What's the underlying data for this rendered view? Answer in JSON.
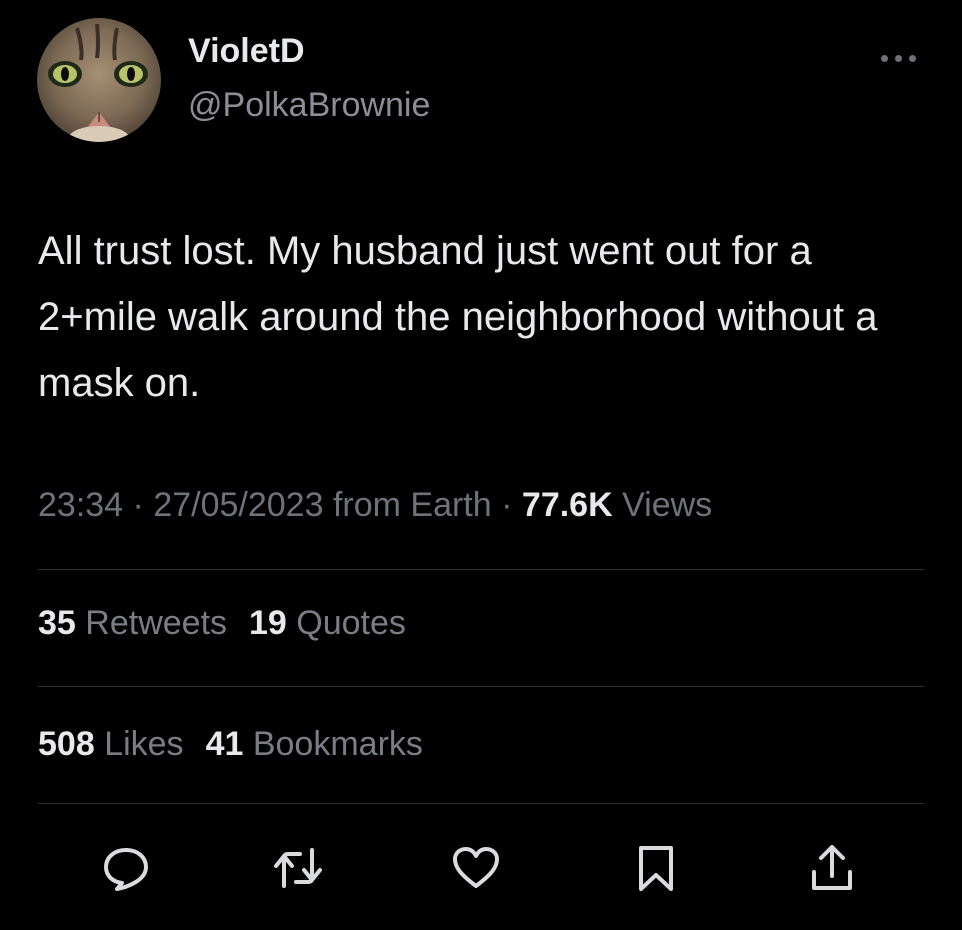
{
  "author": {
    "display_name": "VioletD",
    "handle": "@PolkaBrownie",
    "avatar_icon": "cat-avatar"
  },
  "more_icon": "more-dots-icon",
  "tweet": {
    "text": "All trust lost. My husband just went out for a 2+mile walk around the neighborhood without a mask on.",
    "time": "23:34",
    "date": "27/05/2023",
    "source": "from Earth",
    "views_count": "77.6K",
    "views_label": "Views"
  },
  "stats": {
    "retweets_count": "35",
    "retweets_label": "Retweets",
    "quotes_count": "19",
    "quotes_label": "Quotes",
    "likes_count": "508",
    "likes_label": "Likes",
    "bookmarks_count": "41",
    "bookmarks_label": "Bookmarks"
  },
  "actions": [
    "reply-icon",
    "retweet-icon",
    "like-icon",
    "bookmark-icon",
    "share-icon"
  ],
  "colors": {
    "background": "#000000",
    "primary_text": "#e7e9ea",
    "secondary_text": "#6e7378",
    "divider": "#2a2d30",
    "icon": "#d9dbdd"
  }
}
